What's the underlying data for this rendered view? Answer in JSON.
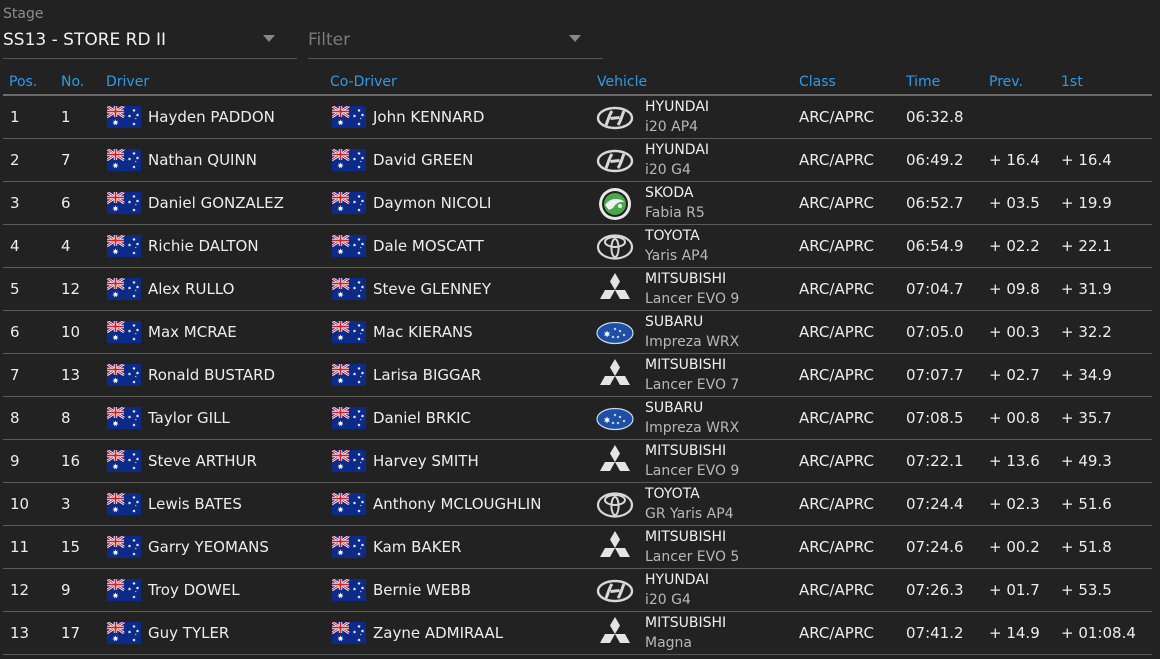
{
  "stage": {
    "label": "Stage",
    "selected": "SS13 - STORE RD II"
  },
  "filter": {
    "placeholder": "Filter"
  },
  "columns": [
    "Pos.",
    "No.",
    "Driver",
    "Co-Driver",
    "Vehicle",
    "Class",
    "Time",
    "Prev.",
    "1st"
  ],
  "rows": [
    {
      "pos": "1",
      "no": "1",
      "driver": "Hayden PADDON",
      "codriver": "John KENNARD",
      "make": "HYUNDAI",
      "model": "i20 AP4",
      "brand": "hyundai",
      "cls": "ARC/APRC",
      "time": "06:32.8",
      "prev": "",
      "first": ""
    },
    {
      "pos": "2",
      "no": "7",
      "driver": "Nathan QUINN",
      "codriver": "David GREEN",
      "make": "HYUNDAI",
      "model": "i20 G4",
      "brand": "hyundai",
      "cls": "ARC/APRC",
      "time": "06:49.2",
      "prev": "+ 16.4",
      "first": "+ 16.4"
    },
    {
      "pos": "3",
      "no": "6",
      "driver": "Daniel GONZALEZ",
      "codriver": "Daymon NICOLI",
      "make": "SKODA",
      "model": "Fabia R5",
      "brand": "skoda",
      "cls": "ARC/APRC",
      "time": "06:52.7",
      "prev": "+ 03.5",
      "first": "+ 19.9"
    },
    {
      "pos": "4",
      "no": "4",
      "driver": "Richie DALTON",
      "codriver": "Dale MOSCATT",
      "make": "TOYOTA",
      "model": "Yaris AP4",
      "brand": "toyota",
      "cls": "ARC/APRC",
      "time": "06:54.9",
      "prev": "+ 02.2",
      "first": "+ 22.1"
    },
    {
      "pos": "5",
      "no": "12",
      "driver": "Alex RULLO",
      "codriver": "Steve GLENNEY",
      "make": "MITSUBISHI",
      "model": "Lancer EVO 9",
      "brand": "mitsubishi",
      "cls": "ARC/APRC",
      "time": "07:04.7",
      "prev": "+ 09.8",
      "first": "+ 31.9"
    },
    {
      "pos": "6",
      "no": "10",
      "driver": "Max MCRAE",
      "codriver": "Mac KIERANS",
      "make": "SUBARU",
      "model": "Impreza WRX",
      "brand": "subaru",
      "cls": "ARC/APRC",
      "time": "07:05.0",
      "prev": "+ 00.3",
      "first": "+ 32.2"
    },
    {
      "pos": "7",
      "no": "13",
      "driver": "Ronald BUSTARD",
      "codriver": "Larisa BIGGAR",
      "make": "MITSUBISHI",
      "model": "Lancer EVO 7",
      "brand": "mitsubishi",
      "cls": "ARC/APRC",
      "time": "07:07.7",
      "prev": "+ 02.7",
      "first": "+ 34.9"
    },
    {
      "pos": "8",
      "no": "8",
      "driver": "Taylor GILL",
      "codriver": "Daniel BRKIC",
      "make": "SUBARU",
      "model": "Impreza WRX",
      "brand": "subaru",
      "cls": "ARC/APRC",
      "time": "07:08.5",
      "prev": "+ 00.8",
      "first": "+ 35.7"
    },
    {
      "pos": "9",
      "no": "16",
      "driver": "Steve ARTHUR",
      "codriver": "Harvey SMITH",
      "make": "MITSUBISHI",
      "model": "Lancer EVO 9",
      "brand": "mitsubishi",
      "cls": "ARC/APRC",
      "time": "07:22.1",
      "prev": "+ 13.6",
      "first": "+ 49.3"
    },
    {
      "pos": "10",
      "no": "3",
      "driver": "Lewis BATES",
      "codriver": "Anthony MCLOUGHLIN",
      "make": "TOYOTA",
      "model": "GR Yaris AP4",
      "brand": "toyota",
      "cls": "ARC/APRC",
      "time": "07:24.4",
      "prev": "+ 02.3",
      "first": "+ 51.6"
    },
    {
      "pos": "11",
      "no": "15",
      "driver": "Garry YEOMANS",
      "codriver": "Kam BAKER",
      "make": "MITSUBISHI",
      "model": "Lancer EVO 5",
      "brand": "mitsubishi",
      "cls": "ARC/APRC",
      "time": "07:24.6",
      "prev": "+ 00.2",
      "first": "+ 51.8"
    },
    {
      "pos": "12",
      "no": "9",
      "driver": "Troy DOWEL",
      "codriver": "Bernie WEBB",
      "make": "HYUNDAI",
      "model": "i20 G4",
      "brand": "hyundai",
      "cls": "ARC/APRC",
      "time": "07:26.3",
      "prev": "+ 01.7",
      "first": "+ 53.5"
    },
    {
      "pos": "13",
      "no": "17",
      "driver": "Guy TYLER",
      "codriver": "Zayne ADMIRAAL",
      "make": "MITSUBISHI",
      "model": "Magna",
      "brand": "mitsubishi",
      "cls": "ARC/APRC",
      "time": "07:41.2",
      "prev": "+ 14.9",
      "first": "+ 01:08.4"
    }
  ],
  "colors": {
    "accent": "#2e9be6",
    "background": "#222222"
  }
}
